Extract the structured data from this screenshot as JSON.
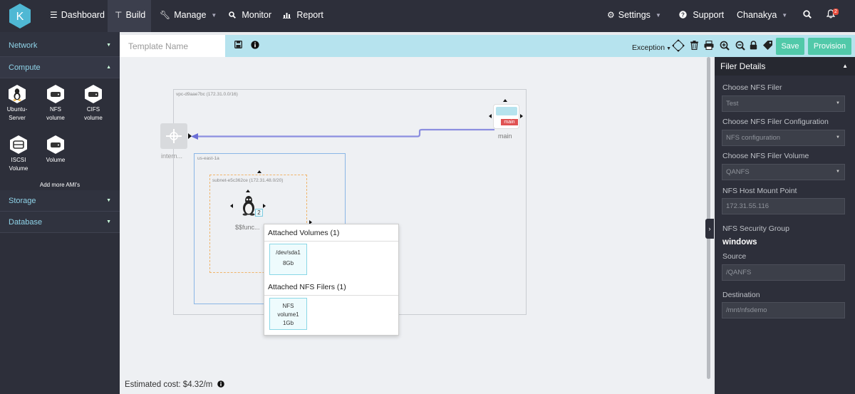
{
  "brand": {
    "logo_letter": "K"
  },
  "nav": {
    "dashboard": "Dashboard",
    "build": "Build",
    "manage": "Manage",
    "monitor": "Monitor",
    "report": "Report",
    "settings": "Settings",
    "support": "Support",
    "user": "Chanakya",
    "notification_count": "2"
  },
  "sidebar": {
    "network": "Network",
    "compute": "Compute",
    "storage": "Storage",
    "database": "Database",
    "amis": [
      {
        "label1": "Ubuntu-",
        "label2": "Server",
        "icon": "linux-icon"
      },
      {
        "label1": "NFS",
        "label2": "volume",
        "icon": "disk-icon"
      },
      {
        "label1": "CIFS",
        "label2": "volume",
        "icon": "disk-icon"
      },
      {
        "label1": "ISCSI",
        "label2": "Volume",
        "icon": "iscsi-icon"
      },
      {
        "label1": "Volume",
        "label2": "",
        "icon": "disk-icon"
      }
    ],
    "add_more": "Add more AMI's"
  },
  "toolbar": {
    "template_placeholder": "Template Name",
    "exception": "Exception",
    "save": "Save",
    "provision": "Provision"
  },
  "canvas": {
    "vpc_label": "vpc-d9aae7bc (172.31.0.0/16)",
    "az_label": "us-east-1a",
    "subnet_label": "subnet-e5c362ce (172.31.48.0/20)",
    "igw_label": "intern...",
    "instance_label": "$$func...",
    "instance_badge": "2",
    "main_label": "main",
    "main_tag": "main",
    "cost_label": "Estimated cost: $4.32/m"
  },
  "popup": {
    "volumes_title": "Attached Volumes (1)",
    "volume": {
      "line1": "/dev/sda1",
      "line2": "8Gb"
    },
    "filers_title": "Attached NFS Filers (1)",
    "filer": {
      "line1": "NFS",
      "line2": "volume1",
      "line3": "1Gb"
    }
  },
  "panel": {
    "title": "Filer Details",
    "choose_filer_label": "Choose NFS Filer",
    "choose_filer_value": "Test",
    "filer_config_label": "Choose NFS Filer Configuration",
    "filer_config_value": "NFS configuration",
    "filer_volume_label": "Choose NFS Filer Volume",
    "filer_volume_value": "QANFS",
    "mount_point_label": "NFS Host Mount Point",
    "mount_point_value": "172.31.55.116",
    "security_group_label": "NFS Security Group",
    "security_group_value": "windows",
    "source_label": "Source",
    "source_value": "/QANFS",
    "destination_label": "Destination",
    "destination_value": "/mnt/nfsdemo"
  },
  "colors": {
    "nav_bg": "#2d2f3a",
    "toolbar_bg": "#b6e3ee",
    "accent_green": "#51c9a9",
    "link_arrow": "#8b8ee0"
  }
}
